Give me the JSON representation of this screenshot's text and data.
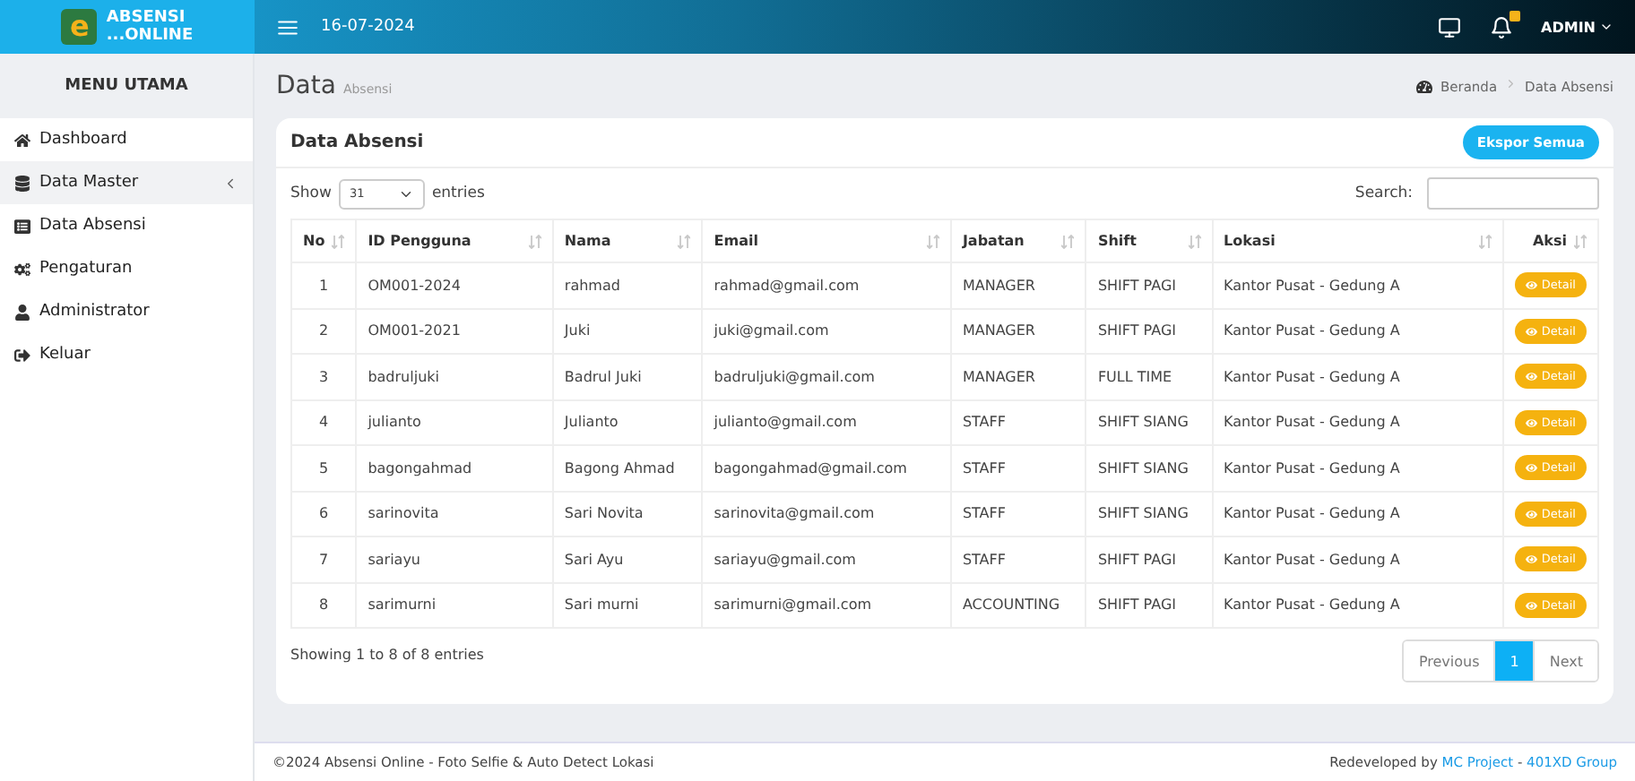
{
  "header": {
    "logo_mark": "e",
    "logo_line1": "ABSENSI",
    "logo_line2": "...ONLINE",
    "date": "16-07-2024",
    "user": "ADMIN",
    "notifications": true
  },
  "sidebar": {
    "title": "MENU UTAMA",
    "items": [
      {
        "label": "Dashboard",
        "selected": false
      },
      {
        "label": "Data Master",
        "selected": true,
        "expanded": false
      },
      {
        "label": "Data Absensi",
        "selected": false
      },
      {
        "label": "Pengaturan",
        "selected": false
      },
      {
        "label": "Administrator",
        "selected": false
      },
      {
        "label": "Keluar",
        "selected": false
      }
    ]
  },
  "page": {
    "title": "Data",
    "subtitle": "Absensi",
    "breadcrumb": [
      "Beranda",
      "Data Absensi"
    ]
  },
  "card": {
    "title": "Data Absensi",
    "export_button": "Ekspor Semua",
    "show_label": "Show",
    "page_size": "31",
    "entries_label": "entries",
    "search_label": "Search:",
    "columns": [
      "No",
      "ID Pengguna",
      "Nama",
      "Email",
      "Jabatan",
      "Shift",
      "Lokasi",
      "Aksi"
    ],
    "rows": [
      {
        "cells": [
          "1",
          "OM001-2024",
          "rahmad",
          "rahmad@gmail.com",
          "MANAGER",
          "SHIFT PAGI",
          "Kantor Pusat - Gedung A"
        ],
        "action": "Detail"
      },
      {
        "cells": [
          "2",
          "OM001-2021",
          "Juki",
          "juki@gmail.com",
          "MANAGER",
          "SHIFT PAGI",
          "Kantor Pusat - Gedung A"
        ],
        "action": "Detail"
      },
      {
        "cells": [
          "3",
          "badruljuki",
          "Badrul Juki",
          "badruljuki@gmail.com",
          "MANAGER",
          "FULL TIME",
          "Kantor Pusat - Gedung A"
        ],
        "action": "Detail"
      },
      {
        "cells": [
          "4",
          "julianto",
          "Julianto",
          "julianto@gmail.com",
          "STAFF",
          "SHIFT SIANG",
          "Kantor Pusat - Gedung A"
        ],
        "action": "Detail"
      },
      {
        "cells": [
          "5",
          "bagongahmad",
          "Bagong Ahmad",
          "bagongahmad@gmail.com",
          "STAFF",
          "SHIFT SIANG",
          "Kantor Pusat - Gedung A"
        ],
        "action": "Detail"
      },
      {
        "cells": [
          "6",
          "sarinovita",
          "Sari Novita",
          "sarinovita@gmail.com",
          "STAFF",
          "SHIFT SIANG",
          "Kantor Pusat - Gedung A"
        ],
        "action": "Detail"
      },
      {
        "cells": [
          "7",
          "sariayu",
          "Sari Ayu",
          "sariayu@gmail.com",
          "STAFF",
          "SHIFT PAGI",
          "Kantor Pusat - Gedung A"
        ],
        "action": "Detail"
      },
      {
        "cells": [
          "8",
          "sarimurni",
          "Sari murni",
          "sarimurni@gmail.com",
          "ACCOUNTING",
          "SHIFT PAGI",
          "Kantor Pusat - Gedung A"
        ],
        "action": "Detail"
      }
    ],
    "info": "Showing 1 to 8 of 8 entries",
    "pagination": [
      {
        "label": "Previous",
        "selected": false
      },
      {
        "label": "1",
        "selected": true
      },
      {
        "label": "Next",
        "selected": false
      }
    ]
  },
  "footer": {
    "left": "©2024 Absensi Online - Foto Selfie & Auto Detect Lokasi",
    "credit_prefix": "Redeveloped by",
    "link1": "MC Project",
    "separator": "-",
    "link2": "401XD Group"
  }
}
